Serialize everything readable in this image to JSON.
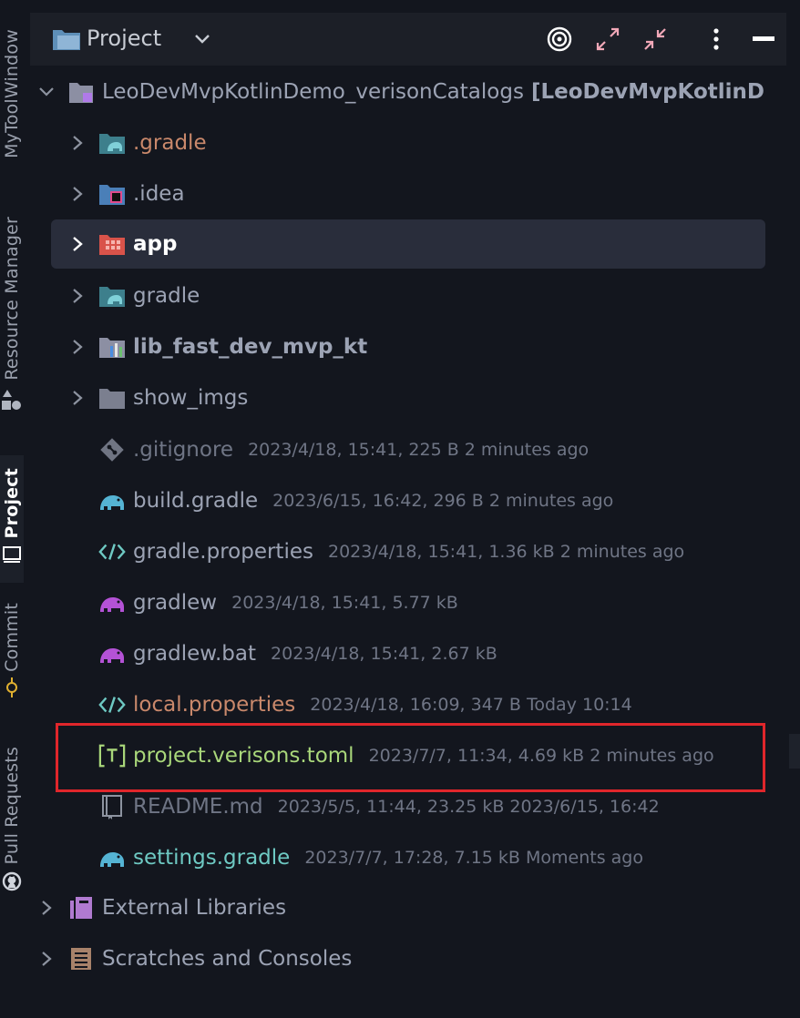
{
  "left_strip": {
    "tabs": [
      {
        "label": "MyToolWindow",
        "active": false
      },
      {
        "label": "Resource Manager",
        "icon": "shapes-icon",
        "active": false
      },
      {
        "label": "Project",
        "icon": "monitor-icon",
        "active": true
      },
      {
        "label": "Commit",
        "icon": "commit-icon",
        "active": false
      },
      {
        "label": "Pull Requests",
        "icon": "github-icon",
        "active": false
      }
    ]
  },
  "header": {
    "title": "Project",
    "icons": [
      "locate-icon",
      "expand-all-icon",
      "collapse-all-icon",
      "more-options-icon",
      "hide-icon"
    ]
  },
  "tree": {
    "root": {
      "name": "LeoDevMvpKotlinDemo_verisonCatalogs",
      "module": "[LeoDevMvpKotlinD"
    },
    "items": [
      {
        "name": ".gradle",
        "meta": "",
        "icon": "gradle-folder-icon",
        "expandable": true
      },
      {
        "name": ".idea",
        "meta": "",
        "icon": "idea-folder-icon",
        "expandable": true
      },
      {
        "name": "app",
        "meta": "",
        "icon": "android-module-icon",
        "expandable": true,
        "selected": true
      },
      {
        "name": "gradle",
        "meta": "",
        "icon": "gradle-folder-icon",
        "expandable": true
      },
      {
        "name": "lib_fast_dev_mvp_kt",
        "meta": "",
        "icon": "library-module-icon",
        "expandable": true
      },
      {
        "name": "show_imgs",
        "meta": "",
        "icon": "folder-icon",
        "expandable": true
      },
      {
        "name": ".gitignore",
        "meta": "2023/4/18, 15:41, 225 B 2 minutes ago",
        "icon": "git-icon"
      },
      {
        "name": "build.gradle",
        "meta": "2023/6/15, 16:42, 296 B 2 minutes ago",
        "icon": "gradle-file-icon"
      },
      {
        "name": "gradle.properties",
        "meta": "2023/4/18, 15:41, 1.36 kB 2 minutes ago",
        "icon": "properties-icon"
      },
      {
        "name": "gradlew",
        "meta": "2023/4/18, 15:41, 5.77 kB",
        "icon": "gradlew-icon"
      },
      {
        "name": "gradlew.bat",
        "meta": "2023/4/18, 15:41, 2.67 kB",
        "icon": "gradlew-icon"
      },
      {
        "name": "local.properties",
        "meta": "2023/4/18, 16:09, 347 B Today 10:14",
        "icon": "properties-icon"
      },
      {
        "name": "project.verisons.toml",
        "meta": "2023/7/7, 11:34, 4.69 kB 2 minutes ago",
        "icon": "toml-icon",
        "highlighted": true
      },
      {
        "name": "README.md",
        "meta": "2023/5/5, 11:44, 23.25 kB 2023/6/15, 16:42",
        "icon": "markdown-icon"
      },
      {
        "name": "settings.gradle",
        "meta": "2023/7/7, 17:28, 7.15 kB Moments ago",
        "icon": "gradle-file-icon"
      }
    ],
    "bottom": [
      {
        "name": "External Libraries",
        "icon": "libraries-icon"
      },
      {
        "name": "Scratches and Consoles",
        "icon": "scratches-icon"
      }
    ]
  },
  "colors": {
    "background": "#13161e",
    "header": "#1c1f27",
    "selection": "#292d3b",
    "highlight_border": "#e0262b",
    "name_default": "#9ca3b4",
    "name_orange": "#c9886b",
    "name_green": "#a9d77a",
    "name_teal": "#6ec9c3",
    "meta": "#6f7585"
  }
}
